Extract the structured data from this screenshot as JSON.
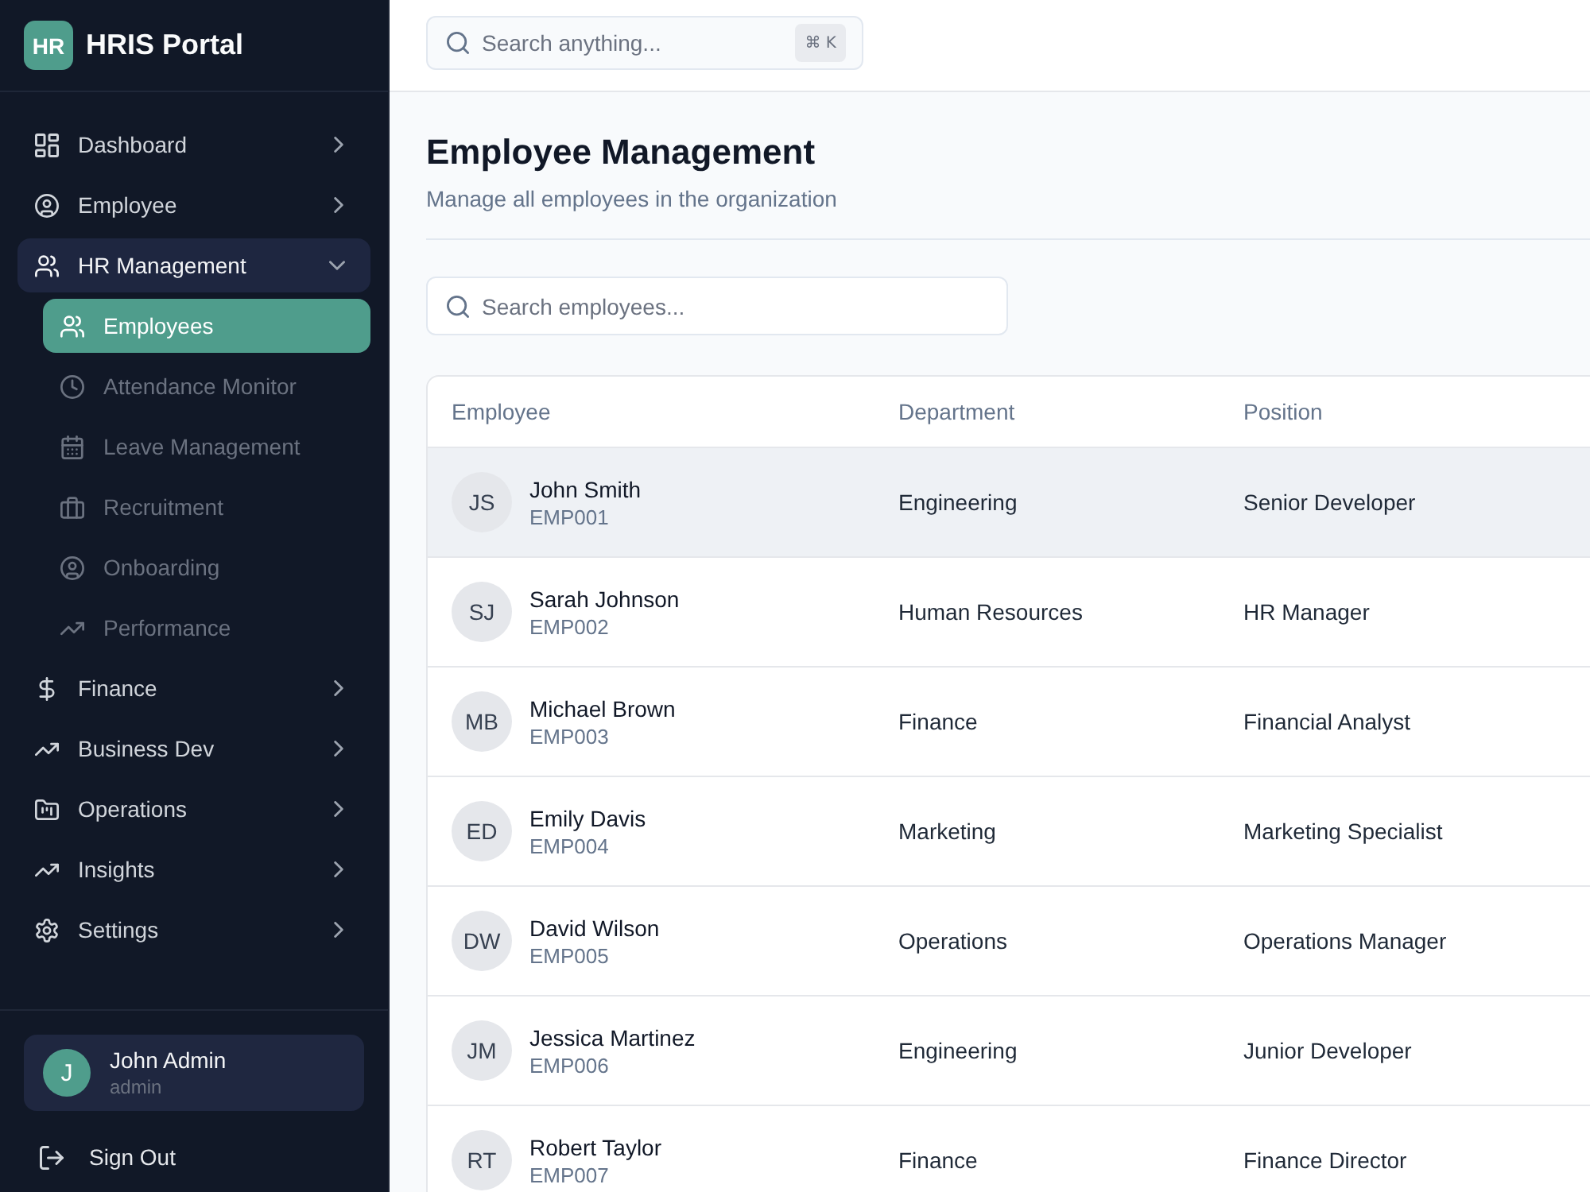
{
  "sidebar": {
    "logo": "HR",
    "title": "HRIS Portal",
    "items": [
      {
        "label": "Dashboard",
        "expanded": false
      },
      {
        "label": "Employee",
        "expanded": false
      },
      {
        "label": "HR Management",
        "expanded": true,
        "children": [
          {
            "label": "Employees",
            "selected": true
          },
          {
            "label": "Attendance Monitor",
            "selected": false
          },
          {
            "label": "Leave Management",
            "selected": false
          },
          {
            "label": "Recruitment",
            "selected": false
          },
          {
            "label": "Onboarding",
            "selected": false
          },
          {
            "label": "Performance",
            "selected": false
          }
        ]
      },
      {
        "label": "Finance",
        "expanded": false
      },
      {
        "label": "Business Dev",
        "expanded": false
      },
      {
        "label": "Operations",
        "expanded": false
      },
      {
        "label": "Insights",
        "expanded": false
      },
      {
        "label": "Settings",
        "expanded": false
      }
    ],
    "user": {
      "initial": "J",
      "name": "John Admin",
      "role": "admin"
    },
    "sign_out": "Sign Out"
  },
  "topbar": {
    "search": {
      "placeholder": "Search anything...",
      "shortcut": "⌘ K"
    }
  },
  "page": {
    "title": "Employee Management",
    "subtitle": "Manage all employees in the organization",
    "search": {
      "placeholder": "Search employees..."
    }
  },
  "table": {
    "columns": [
      "Employee",
      "Department",
      "Position"
    ],
    "rows": [
      {
        "initials": "JS",
        "name": "John Smith",
        "id": "EMP001",
        "department": "Engineering",
        "position": "Senior Developer",
        "selected": true
      },
      {
        "initials": "SJ",
        "name": "Sarah Johnson",
        "id": "EMP002",
        "department": "Human Resources",
        "position": "HR Manager",
        "selected": false
      },
      {
        "initials": "MB",
        "name": "Michael Brown",
        "id": "EMP003",
        "department": "Finance",
        "position": "Financial Analyst",
        "selected": false
      },
      {
        "initials": "ED",
        "name": "Emily Davis",
        "id": "EMP004",
        "department": "Marketing",
        "position": "Marketing Specialist",
        "selected": false
      },
      {
        "initials": "DW",
        "name": "David Wilson",
        "id": "EMP005",
        "department": "Operations",
        "position": "Operations Manager",
        "selected": false
      },
      {
        "initials": "JM",
        "name": "Jessica Martinez",
        "id": "EMP006",
        "department": "Engineering",
        "position": "Junior Developer",
        "selected": false
      },
      {
        "initials": "RT",
        "name": "Robert Taylor",
        "id": "EMP007",
        "department": "Finance",
        "position": "Finance Director",
        "selected": false
      }
    ]
  }
}
